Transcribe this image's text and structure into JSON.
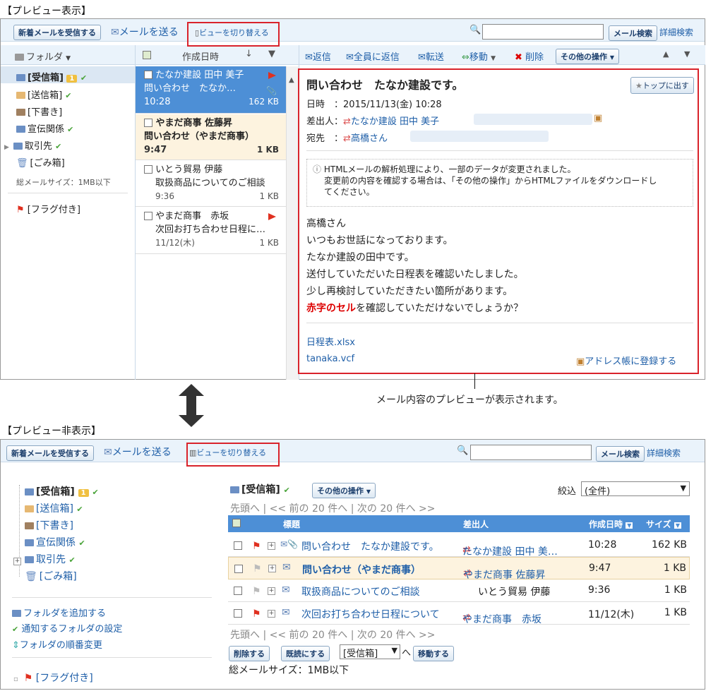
{
  "top": {
    "section_title": "【プレビュー表示】",
    "toolbar": {
      "receive": "新着メールを受信する",
      "send": "メールを送る",
      "switch_view": "ビューを切り替える",
      "search_btn": "メール検索",
      "adv_search": "詳細検索"
    },
    "folder_header": "フォルダ",
    "folders": [
      {
        "label": "[受信箱]",
        "badge": "1"
      },
      {
        "label": "[送信箱]"
      },
      {
        "label": "[下書き]"
      },
      {
        "label": "宣伝関係"
      },
      {
        "label": "取引先"
      },
      {
        "label": "[ごみ箱]"
      }
    ],
    "total_size": "総メールサイズ：1MB以下",
    "flagged": "[フラグ付き]",
    "list_header": "作成日時",
    "actions": {
      "reply": "返信",
      "reply_all": "全員に返信",
      "forward": "転送",
      "move": "移動",
      "delete": "削除",
      "other": "その他の操作"
    },
    "messages": [
      {
        "sender": "たなか建設 田中 美子",
        "subject": "問い合わせ　たなか…",
        "time": "10:28",
        "size": "162 KB"
      },
      {
        "sender": "やまだ商事 佐藤昇",
        "subject": "問い合わせ（やまだ商事）",
        "time": "9:47",
        "size": "1 KB"
      },
      {
        "sender": "いとう貿易 伊藤",
        "subject": "取扱商品についてのご相談",
        "time": "9:36",
        "size": "1 KB"
      },
      {
        "sender": "やまだ商事　赤坂",
        "subject": "次回お打ち合わせ日程に…",
        "time": "11/12(木)",
        "size": "1 KB"
      }
    ],
    "preview": {
      "title": "問い合わせ　たなか建設です。",
      "to_top": "トップに出す",
      "date_label": "日時",
      "date_value": "：2015/11/13(金) 10:28",
      "from_label": "差出人：",
      "from_value": "たなか建設 田中 美子",
      "to_label": "宛先",
      "to_sep": "：",
      "to_value": "高橋さん",
      "notice1": "HTMLメールの解析処理により、一部のデータが変更されました。",
      "notice2": "変更前の内容を確認する場合は、「その他の操作」からHTMLファイルをダウンロードし",
      "notice3": "てください。",
      "body": [
        "高橋さん",
        "いつもお世話になっております。",
        "たなか建設の田中です。",
        "送付していただいた日程表を確認いたしました。",
        "少し再検討していただきたい箇所があります。"
      ],
      "body_red": "赤字のセル",
      "body_last": "を確認していただけないでしょうか？",
      "attach1": "日程表.xlsx",
      "attach2": "tanaka.vcf",
      "addr_book": "アドレス帳に登録する"
    },
    "caption": "メール内容のプレビューが表示されます。"
  },
  "bottom": {
    "section_title": "【プレビュー非表示】",
    "folders": [
      {
        "label": "[受信箱]",
        "badge": "1"
      },
      {
        "label": "[送信箱]"
      },
      {
        "label": "[下書き]"
      },
      {
        "label": "宣伝関係"
      },
      {
        "label": "取引先"
      },
      {
        "label": "[ごみ箱]"
      }
    ],
    "add_folder": "フォルダを追加する",
    "notify": "通知するフォルダの設定",
    "reorder": "フォルダの順番変更",
    "flagged": "[フラグ付き]",
    "current_folder": "[受信箱]",
    "other": "その他の操作",
    "filter_label": "絞込",
    "filter_value": "(全件)",
    "pager": {
      "first": "先頭へ",
      "prev": "<< 前の 20 件へ",
      "next": "次の 20 件へ >>"
    },
    "columns": {
      "subject": "標題",
      "sender": "差出人",
      "date": "作成日時",
      "size": "サイズ"
    },
    "rows": [
      {
        "subject": "問い合わせ　たなか建設です。",
        "sender": "たなか建設 田中 美…",
        "date": "10:28",
        "size": "162 KB"
      },
      {
        "subject": "問い合わせ（やまだ商事）",
        "sender": "やまだ商事 佐藤昇",
        "date": "9:47",
        "size": "1 KB"
      },
      {
        "subject": "取扱商品についてのご相談",
        "sender": "いとう貿易 伊藤",
        "date": "9:36",
        "size": "1 KB"
      },
      {
        "subject": "次回お打ち合わせ日程について",
        "sender": "やまだ商事　赤坂",
        "date": "11/12(木)",
        "size": "1 KB"
      }
    ],
    "delete_btn": "削除する",
    "read_btn": "既読にする",
    "move_select": "[受信箱]",
    "move_to": "へ",
    "move_btn": "移動する",
    "total_size": "総メールサイズ：1MB以下"
  }
}
